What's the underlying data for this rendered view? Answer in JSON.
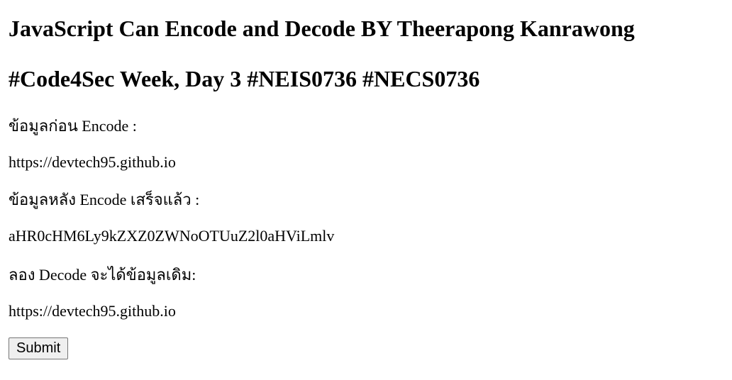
{
  "header": {
    "title": "JavaScript Can Encode and Decode BY Theerapong Kanrawong",
    "subtitle": "#Code4Sec Week, Day 3 #NEIS0736 #NECS0736"
  },
  "content": {
    "before_label": "ข้อมูลก่อน Encode :",
    "before_value": "https://devtech95.github.io",
    "after_label": "ข้อมูลหลัง Encode เสร็จแล้ว :",
    "after_value": "aHR0cHM6Ly9kZXZ0ZWNoOTUuZ2l0aHViLmlv",
    "decode_label": "ลอง Decode จะได้ข้อมูลเดิม:",
    "decode_value": "https://devtech95.github.io"
  },
  "form": {
    "submit_label": "Submit"
  }
}
